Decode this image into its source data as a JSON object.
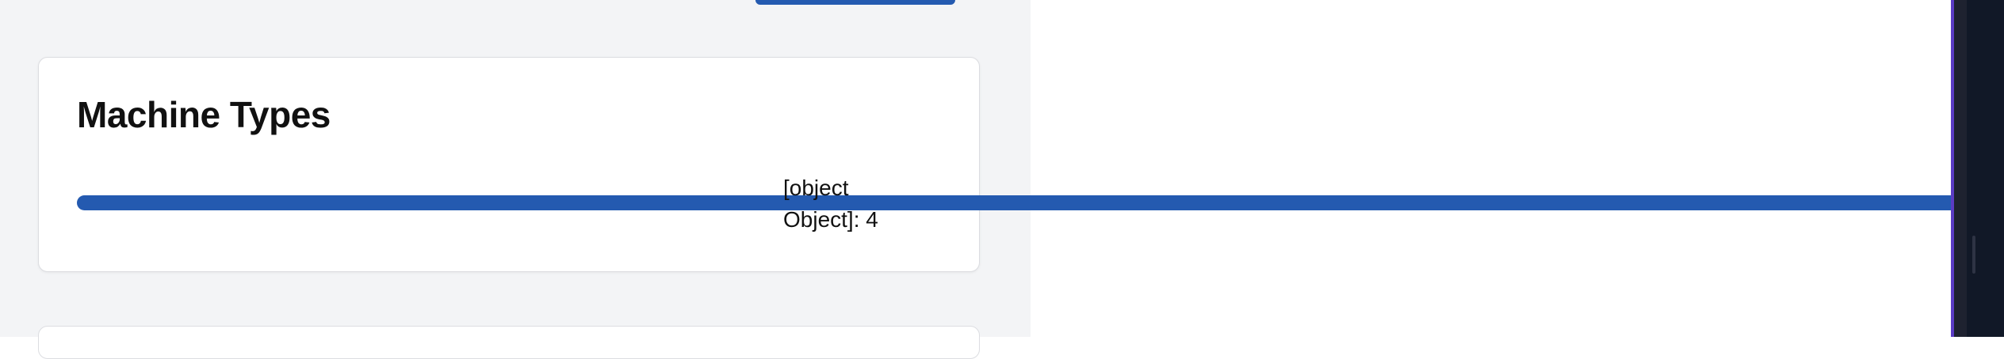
{
  "card": {
    "title": "Machine Types",
    "bar_label": "[object Object]: 4",
    "bar_value": 4
  },
  "colors": {
    "bar": "#245ab0",
    "accent_border": "#5b3cc4",
    "sidebar": "#111827"
  }
}
